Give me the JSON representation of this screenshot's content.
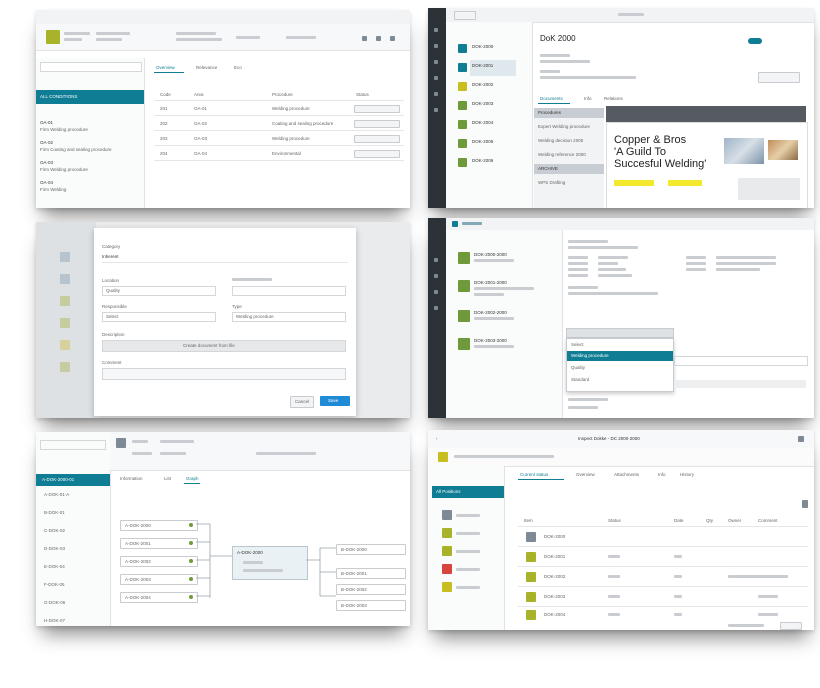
{
  "panel1": {
    "tabs": [
      "Overview",
      "Relevance",
      "Eco"
    ],
    "sidebar_header": "ALL CONDITIONS",
    "sidebar_items": [
      {
        "code": "OA-01",
        "desc": "Firm Welding procedure"
      },
      {
        "code": "OA-02",
        "desc": "Firm Coating and sealing procedure"
      },
      {
        "code": "OA-03",
        "desc": "Firm Welding procedure"
      },
      {
        "code": "OA-04",
        "desc": "Firm Welding"
      }
    ],
    "table_headers": [
      "Code",
      "Area",
      "Procedure",
      "Status"
    ],
    "rows": [
      [
        "201",
        "OA-01",
        "Welding procedure",
        ""
      ],
      [
        "202",
        "OA-02",
        "Coating and sealing procedure",
        ""
      ],
      [
        "203",
        "OA-03",
        "Welding procedure",
        ""
      ],
      [
        "204",
        "OA-04",
        "Environmental",
        ""
      ]
    ]
  },
  "panel2": {
    "doc_title": "DoK 2000",
    "list_items": [
      "DOK-2000",
      "DOK-2001",
      "DOK-2002",
      "DOK-2003",
      "DOK-2004",
      "DOK-2005",
      "DOK-2006"
    ],
    "tabs": [
      "Documents",
      "Info",
      "Relations"
    ],
    "menu_items": [
      "Procedures",
      "Expert Welding procedure",
      "Welding decision 2000",
      "Welding reference 2000",
      "ARCHIVE",
      "WPS Drafting"
    ],
    "preview_headline": [
      "Copper & Bros",
      "'A Guild To",
      "Succesful Welding'"
    ]
  },
  "panel3": {
    "fields": [
      "Category",
      "Location",
      "Responsible",
      "Type",
      "Description",
      "Comment"
    ],
    "values": [
      "Inherent",
      "Quality",
      "Select",
      "Welding procedure",
      "Create document from file",
      ""
    ],
    "cancel": "Cancel",
    "save": "Save"
  },
  "panel4": {
    "list_items": [
      "DOK-2000-2000",
      "DOK-2001-2000",
      "DOK-2002-2000",
      "DOK-2003-2000"
    ],
    "dropdown_options": [
      "Select",
      "Welding procedure",
      "Quality",
      "Standard"
    ]
  },
  "panel5": {
    "tree_items": [
      "A-DOK-2000-01",
      "A-DOK-01-A",
      "B-DOK-01",
      "C-DOK-02",
      "D-DOK-03",
      "E-DOK-04",
      "F-DOK-05",
      "G-DOK-06",
      "H-DOK-07"
    ],
    "tabs": [
      "Information",
      "List",
      "Graph"
    ],
    "node_labels": [
      "A-DOK-2000",
      "A-DOK-2001",
      "A-DOK-2002",
      "A-DOK-2003",
      "A-DOK-2004"
    ],
    "center_title": "A-DOK-2000",
    "right_nodes": [
      "B-DOK-2000",
      "B-DOK-2001",
      "B-DOK-2002",
      "B-DOK-2003"
    ]
  },
  "panel6": {
    "window_title": "Inspect Dokke - DC 2000-2000",
    "tabs": [
      "Current status",
      "Overview",
      "Attachments",
      "Info",
      "History"
    ],
    "sidebar_header": "All Positions",
    "colors": [
      "#7e8a96",
      "#a8b32a",
      "#a8b32a",
      "#d8443c",
      "#c8be20"
    ],
    "headers": [
      "Item",
      "Status",
      "Date",
      "Qty",
      "Owner",
      "Comment"
    ],
    "rows": [
      "DOK-2000",
      "DOK-2001",
      "DOK-2002",
      "DOK-2003",
      "DOK-2004",
      "DOK-2005"
    ]
  }
}
